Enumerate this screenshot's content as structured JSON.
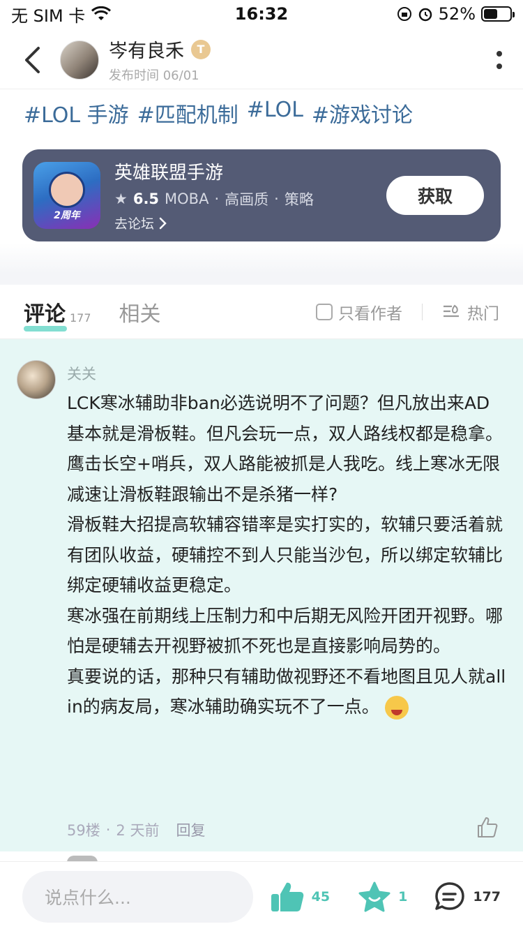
{
  "status_bar": {
    "carrier": "无 SIM 卡",
    "time": "16:32",
    "battery": "52%",
    "battery_level": 0.52
  },
  "header": {
    "author_name": "岑有良禾",
    "badge": "T",
    "publish_time": "发布时间 06/01"
  },
  "tags": [
    "#LOL 手游",
    "#匹配机制",
    "#LOL",
    "#游戏讨论"
  ],
  "game_card": {
    "name": "英雄联盟手游",
    "rating": "6.5",
    "meta": [
      "MOBA",
      "·",
      "高画质",
      "·",
      "策略"
    ],
    "forum_link": "去论坛",
    "get_button": "获取",
    "icon_text": "2周年"
  },
  "tabs": {
    "comments_label": "评论",
    "comments_count": "177",
    "related_label": "相关",
    "author_only": "只看作者",
    "sort_label": "热门"
  },
  "comment": {
    "user": "关关",
    "paragraphs": [
      "LCK寒冰辅助非ban必选说明不了问题？但凡放出来AD基本就是滑板鞋。但凡会玩一点，双人路线权都是稳拿。鹰击长空+哨兵，双人路能被抓是人我吃。线上寒冰无限减速让滑板鞋跟输出不是杀猪一样?",
      "滑板鞋大招提高软辅容错率是实打实的，软辅只要活着就有团队收益，硬辅控不到人只能当沙包，所以绑定软辅比绑定硬辅收益更稳定。",
      "寒冰强在前期线上压制力和中后期无风险开团开视野。哪怕是硬辅去开视野被抓不死也是直接影响局势的。",
      "真要说的话，那种只有辅助做视野还不看地图且见人就all in的病友局，寒冰辅助确实玩不了一点。"
    ],
    "floor": "59楼",
    "dot": "·",
    "time": "2 天前",
    "reply": "回复"
  },
  "bottom_bar": {
    "input_placeholder": "说点什么...",
    "likes": "45",
    "favorites": "1",
    "comments": "177"
  },
  "colors": {
    "accent": "#4fc4b5",
    "card_bg": "#545b75",
    "comment_bg": "#e6f7f5",
    "tag": "#3b6b99"
  }
}
